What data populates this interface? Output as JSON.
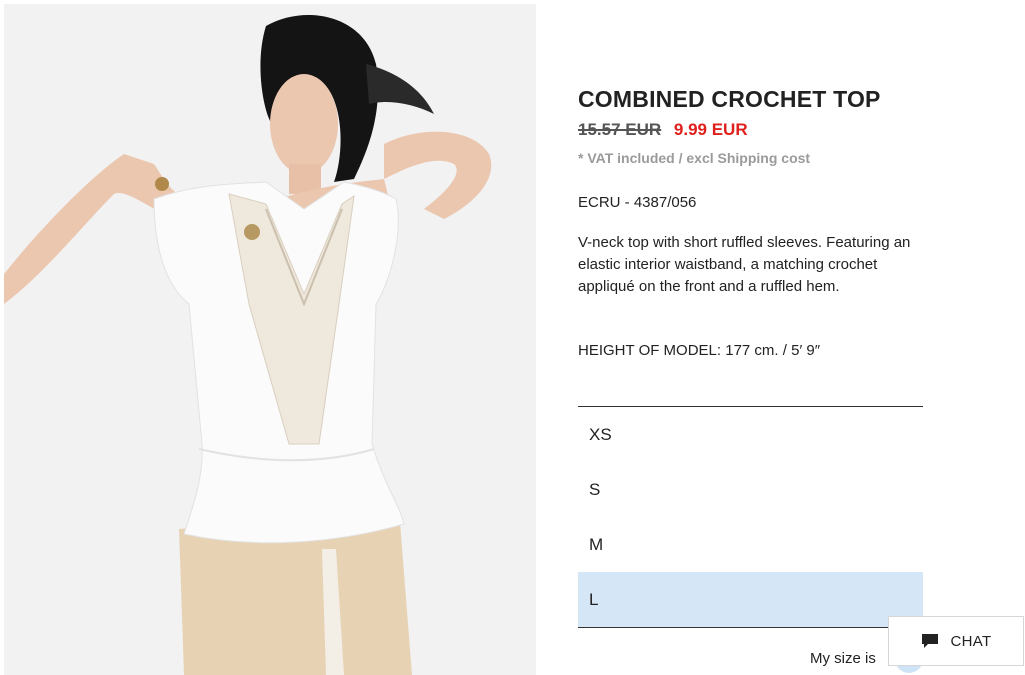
{
  "product": {
    "title": "COMBINED CROCHET TOP",
    "old_price": "15.57 EUR",
    "new_price": "9.99 EUR",
    "vat_note": "* VAT included / excl Shipping cost",
    "color_ref": "ECRU - 4387/056",
    "description": "V-neck top with short ruffled sleeves. Featuring an elastic interior waistband, a matching crochet appliqué on the front and a ruffled hem.",
    "model_height": "HEIGHT OF MODEL: 177 cm. / 5′ 9″"
  },
  "sizes": {
    "options": [
      "XS",
      "S",
      "M",
      "L"
    ],
    "selected": "L"
  },
  "my_size": {
    "label": "My size is"
  },
  "chat": {
    "label": "CHAT",
    "icon": "chat-bubble-icon"
  },
  "colors": {
    "sale_red": "#e0201c",
    "selected_size_bg": "#d5e6f7"
  }
}
